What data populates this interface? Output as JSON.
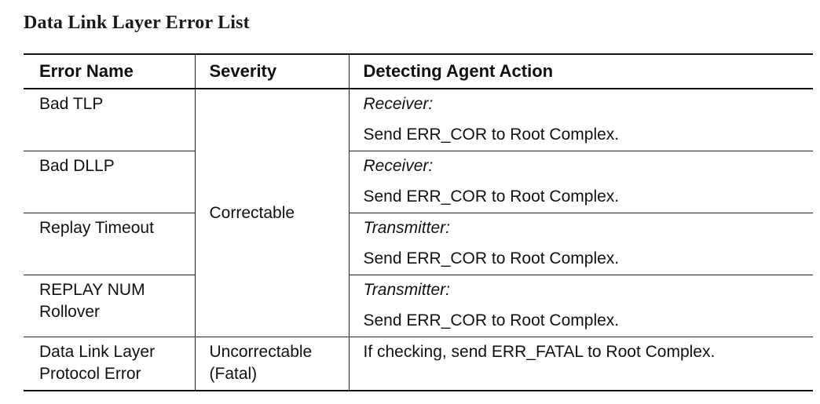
{
  "title": "Data Link Layer Error List",
  "table": {
    "headers": {
      "error_name": "Error Name",
      "severity": "Severity",
      "action": "Detecting Agent Action"
    },
    "correctable_label": "Correctable",
    "rows": [
      {
        "name_line1": "Bad TLP",
        "name_line2": "",
        "agent": "Receiver:",
        "action": "Send ERR_COR to Root Complex."
      },
      {
        "name_line1": "Bad DLLP",
        "name_line2": "",
        "agent": "Receiver:",
        "action": "Send ERR_COR to Root Complex."
      },
      {
        "name_line1": "Replay Timeout",
        "name_line2": "",
        "agent": "Transmitter:",
        "action": "Send ERR_COR to Root Complex."
      },
      {
        "name_line1": "REPLAY NUM",
        "name_line2": "Rollover",
        "agent": "Transmitter:",
        "action": "Send ERR_COR to Root Complex."
      }
    ],
    "fatal_row": {
      "name_line1": "Data Link Layer",
      "name_line2": "Protocol Error",
      "severity_line1": "Uncorrectable",
      "severity_line2": "(Fatal)",
      "action": "If checking, send ERR_FATAL to Root Complex."
    }
  }
}
